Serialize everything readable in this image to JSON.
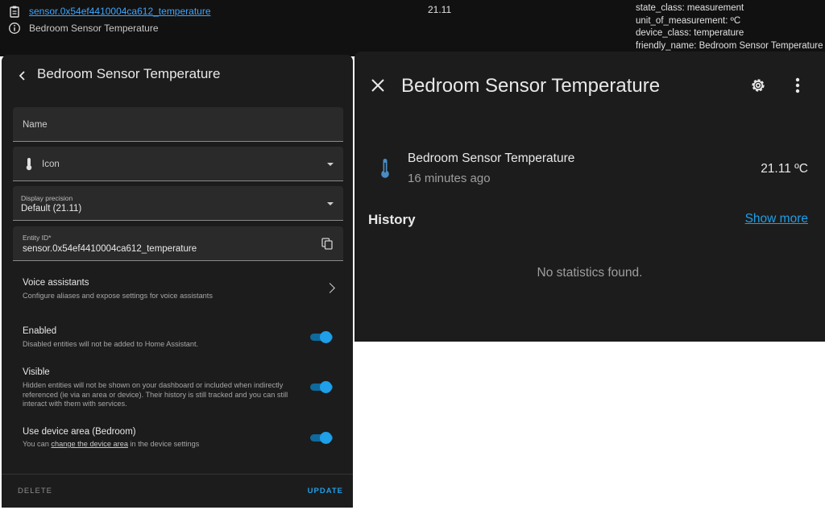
{
  "states_row": {
    "entity_id_link": "sensor.0x54ef4410004ca612_temperature",
    "friendly_name": "Bedroom Sensor Temperature",
    "state": "21.11",
    "attributes": [
      "state_class: measurement",
      "unit_of_measurement: ºC",
      "device_class: temperature",
      "friendly_name: Bedroom Sensor Temperature"
    ],
    "icons": [
      "clipboard-icon",
      "info-icon"
    ]
  },
  "settings_dialog": {
    "title": "Bedroom Sensor Temperature",
    "name_placeholder": "Name",
    "icon_placeholder": "Icon",
    "display_precision": {
      "label": "Display precision",
      "value": "Default (21.11)"
    },
    "entity_id": {
      "label": "Entity ID*",
      "value": "sensor.0x54ef4410004ca612_temperature"
    },
    "voice": {
      "title": "Voice assistants",
      "desc": "Configure aliases and expose settings for voice assistants"
    },
    "enabled": {
      "title": "Enabled",
      "desc": "Disabled entities will not be added to Home Assistant.",
      "on": true
    },
    "visible": {
      "title": "Visible",
      "desc": "Hidden entities will not be shown on your dashboard or included when indirectly referenced (ie via an area or device). Their history is still tracked and you can still interact with them with services.",
      "on": true
    },
    "device_area": {
      "title": "Use device area (Bedroom)",
      "desc_prefix": "You can ",
      "desc_link": "change the device area",
      "desc_suffix": " in the device settings",
      "on": true
    },
    "delete_label": "DELETE",
    "update_label": "UPDATE"
  },
  "more_info": {
    "title": "Bedroom Sensor Temperature",
    "entity_name": "Bedroom Sensor Temperature",
    "last_changed": "16 minutes ago",
    "state": "21.11 ºC",
    "history_label": "History",
    "show_more": "Show more",
    "no_stats": "No statistics found."
  },
  "colors": {
    "accent": "#1e9fe8",
    "link": "#3ea6ff",
    "surface": "#1c1c1c",
    "field": "#2a2a2a",
    "thermometer": "#4a8bc2"
  }
}
